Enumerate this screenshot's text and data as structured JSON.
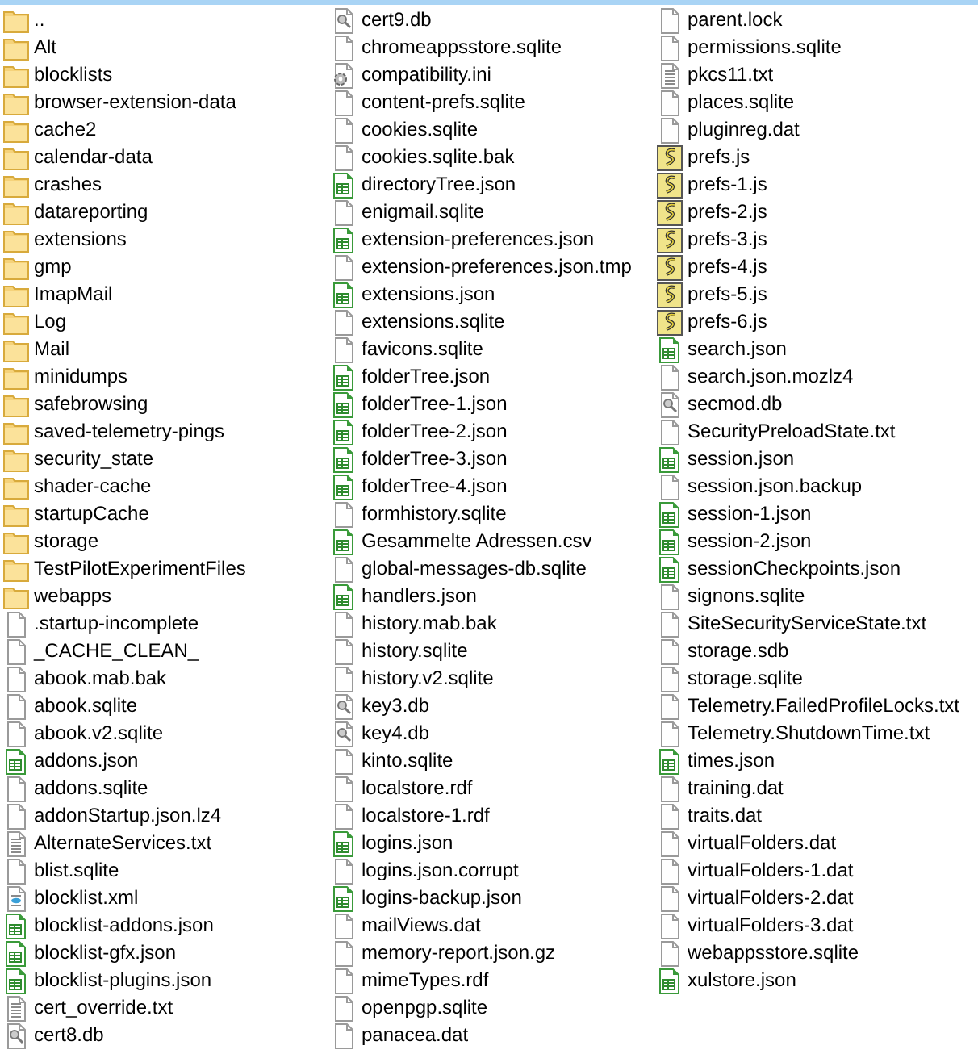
{
  "columns": [
    {
      "items": [
        {
          "name": "..",
          "kind": "folder"
        },
        {
          "name": "Alt",
          "kind": "folder"
        },
        {
          "name": "blocklists",
          "kind": "folder"
        },
        {
          "name": "browser-extension-data",
          "kind": "folder"
        },
        {
          "name": "cache2",
          "kind": "folder"
        },
        {
          "name": "calendar-data",
          "kind": "folder"
        },
        {
          "name": "crashes",
          "kind": "folder"
        },
        {
          "name": "datareporting",
          "kind": "folder"
        },
        {
          "name": "extensions",
          "kind": "folder"
        },
        {
          "name": "gmp",
          "kind": "folder"
        },
        {
          "name": "ImapMail",
          "kind": "folder"
        },
        {
          "name": "Log",
          "kind": "folder"
        },
        {
          "name": "Mail",
          "kind": "folder"
        },
        {
          "name": "minidumps",
          "kind": "folder"
        },
        {
          "name": "safebrowsing",
          "kind": "folder"
        },
        {
          "name": "saved-telemetry-pings",
          "kind": "folder"
        },
        {
          "name": "security_state",
          "kind": "folder"
        },
        {
          "name": "shader-cache",
          "kind": "folder"
        },
        {
          "name": "startupCache",
          "kind": "folder"
        },
        {
          "name": "storage",
          "kind": "folder"
        },
        {
          "name": "TestPilotExperimentFiles",
          "kind": "folder"
        },
        {
          "name": "webapps",
          "kind": "folder"
        },
        {
          "name": ".startup-incomplete",
          "kind": "file"
        },
        {
          "name": "_CACHE_CLEAN_",
          "kind": "file"
        },
        {
          "name": "abook.mab.bak",
          "kind": "file"
        },
        {
          "name": "abook.sqlite",
          "kind": "file"
        },
        {
          "name": "abook.v2.sqlite",
          "kind": "file"
        },
        {
          "name": "addons.json",
          "kind": "sheet"
        },
        {
          "name": "addons.sqlite",
          "kind": "file"
        },
        {
          "name": "addonStartup.json.lz4",
          "kind": "file"
        },
        {
          "name": "AlternateServices.txt",
          "kind": "text"
        },
        {
          "name": "blist.sqlite",
          "kind": "file"
        },
        {
          "name": "blocklist.xml",
          "kind": "xml"
        },
        {
          "name": "blocklist-addons.json",
          "kind": "sheet"
        },
        {
          "name": "blocklist-gfx.json",
          "kind": "sheet"
        },
        {
          "name": "blocklist-plugins.json",
          "kind": "sheet"
        },
        {
          "name": "cert_override.txt",
          "kind": "text"
        },
        {
          "name": "cert8.db",
          "kind": "key"
        }
      ]
    },
    {
      "items": [
        {
          "name": "cert9.db",
          "kind": "key"
        },
        {
          "name": "chromeappsstore.sqlite",
          "kind": "file"
        },
        {
          "name": "compatibility.ini",
          "kind": "gear"
        },
        {
          "name": "content-prefs.sqlite",
          "kind": "file"
        },
        {
          "name": "cookies.sqlite",
          "kind": "file"
        },
        {
          "name": "cookies.sqlite.bak",
          "kind": "file"
        },
        {
          "name": "directoryTree.json",
          "kind": "sheet"
        },
        {
          "name": "enigmail.sqlite",
          "kind": "file"
        },
        {
          "name": "extension-preferences.json",
          "kind": "sheet"
        },
        {
          "name": "extension-preferences.json.tmp",
          "kind": "file"
        },
        {
          "name": "extensions.json",
          "kind": "sheet"
        },
        {
          "name": "extensions.sqlite",
          "kind": "file"
        },
        {
          "name": "favicons.sqlite",
          "kind": "file"
        },
        {
          "name": "folderTree.json",
          "kind": "sheet"
        },
        {
          "name": "folderTree-1.json",
          "kind": "sheet"
        },
        {
          "name": "folderTree-2.json",
          "kind": "sheet"
        },
        {
          "name": "folderTree-3.json",
          "kind": "sheet"
        },
        {
          "name": "folderTree-4.json",
          "kind": "sheet"
        },
        {
          "name": "formhistory.sqlite",
          "kind": "file"
        },
        {
          "name": "Gesammelte Adressen.csv",
          "kind": "sheet"
        },
        {
          "name": "global-messages-db.sqlite",
          "kind": "file"
        },
        {
          "name": "handlers.json",
          "kind": "sheet"
        },
        {
          "name": "history.mab.bak",
          "kind": "file"
        },
        {
          "name": "history.sqlite",
          "kind": "file"
        },
        {
          "name": "history.v2.sqlite",
          "kind": "file"
        },
        {
          "name": "key3.db",
          "kind": "key"
        },
        {
          "name": "key4.db",
          "kind": "key"
        },
        {
          "name": "kinto.sqlite",
          "kind": "file"
        },
        {
          "name": "localstore.rdf",
          "kind": "file"
        },
        {
          "name": "localstore-1.rdf",
          "kind": "file"
        },
        {
          "name": "logins.json",
          "kind": "sheet"
        },
        {
          "name": "logins.json.corrupt",
          "kind": "file"
        },
        {
          "name": "logins-backup.json",
          "kind": "sheet"
        },
        {
          "name": "mailViews.dat",
          "kind": "file"
        },
        {
          "name": "memory-report.json.gz",
          "kind": "file"
        },
        {
          "name": "mimeTypes.rdf",
          "kind": "file"
        },
        {
          "name": "openpgp.sqlite",
          "kind": "file"
        },
        {
          "name": "panacea.dat",
          "kind": "file"
        }
      ]
    },
    {
      "items": [
        {
          "name": "parent.lock",
          "kind": "file"
        },
        {
          "name": "permissions.sqlite",
          "kind": "file"
        },
        {
          "name": "pkcs11.txt",
          "kind": "text"
        },
        {
          "name": "places.sqlite",
          "kind": "file"
        },
        {
          "name": "pluginreg.dat",
          "kind": "file"
        },
        {
          "name": "prefs.js",
          "kind": "script"
        },
        {
          "name": "prefs-1.js",
          "kind": "script"
        },
        {
          "name": "prefs-2.js",
          "kind": "script"
        },
        {
          "name": "prefs-3.js",
          "kind": "script"
        },
        {
          "name": "prefs-4.js",
          "kind": "script"
        },
        {
          "name": "prefs-5.js",
          "kind": "script"
        },
        {
          "name": "prefs-6.js",
          "kind": "script"
        },
        {
          "name": "search.json",
          "kind": "sheet"
        },
        {
          "name": "search.json.mozlz4",
          "kind": "file"
        },
        {
          "name": "secmod.db",
          "kind": "key"
        },
        {
          "name": "SecurityPreloadState.txt",
          "kind": "file"
        },
        {
          "name": "session.json",
          "kind": "sheet"
        },
        {
          "name": "session.json.backup",
          "kind": "file"
        },
        {
          "name": "session-1.json",
          "kind": "sheet"
        },
        {
          "name": "session-2.json",
          "kind": "sheet"
        },
        {
          "name": "sessionCheckpoints.json",
          "kind": "sheet"
        },
        {
          "name": "signons.sqlite",
          "kind": "file"
        },
        {
          "name": "SiteSecurityServiceState.txt",
          "kind": "file"
        },
        {
          "name": "storage.sdb",
          "kind": "file"
        },
        {
          "name": "storage.sqlite",
          "kind": "file"
        },
        {
          "name": "Telemetry.FailedProfileLocks.txt",
          "kind": "file"
        },
        {
          "name": "Telemetry.ShutdownTime.txt",
          "kind": "file"
        },
        {
          "name": "times.json",
          "kind": "sheet"
        },
        {
          "name": "training.dat",
          "kind": "file"
        },
        {
          "name": "traits.dat",
          "kind": "file"
        },
        {
          "name": "virtualFolders.dat",
          "kind": "file"
        },
        {
          "name": "virtualFolders-1.dat",
          "kind": "file"
        },
        {
          "name": "virtualFolders-2.dat",
          "kind": "file"
        },
        {
          "name": "virtualFolders-3.dat",
          "kind": "file"
        },
        {
          "name": "webappsstore.sqlite",
          "kind": "file"
        },
        {
          "name": "xulstore.json",
          "kind": "sheet"
        }
      ]
    }
  ]
}
